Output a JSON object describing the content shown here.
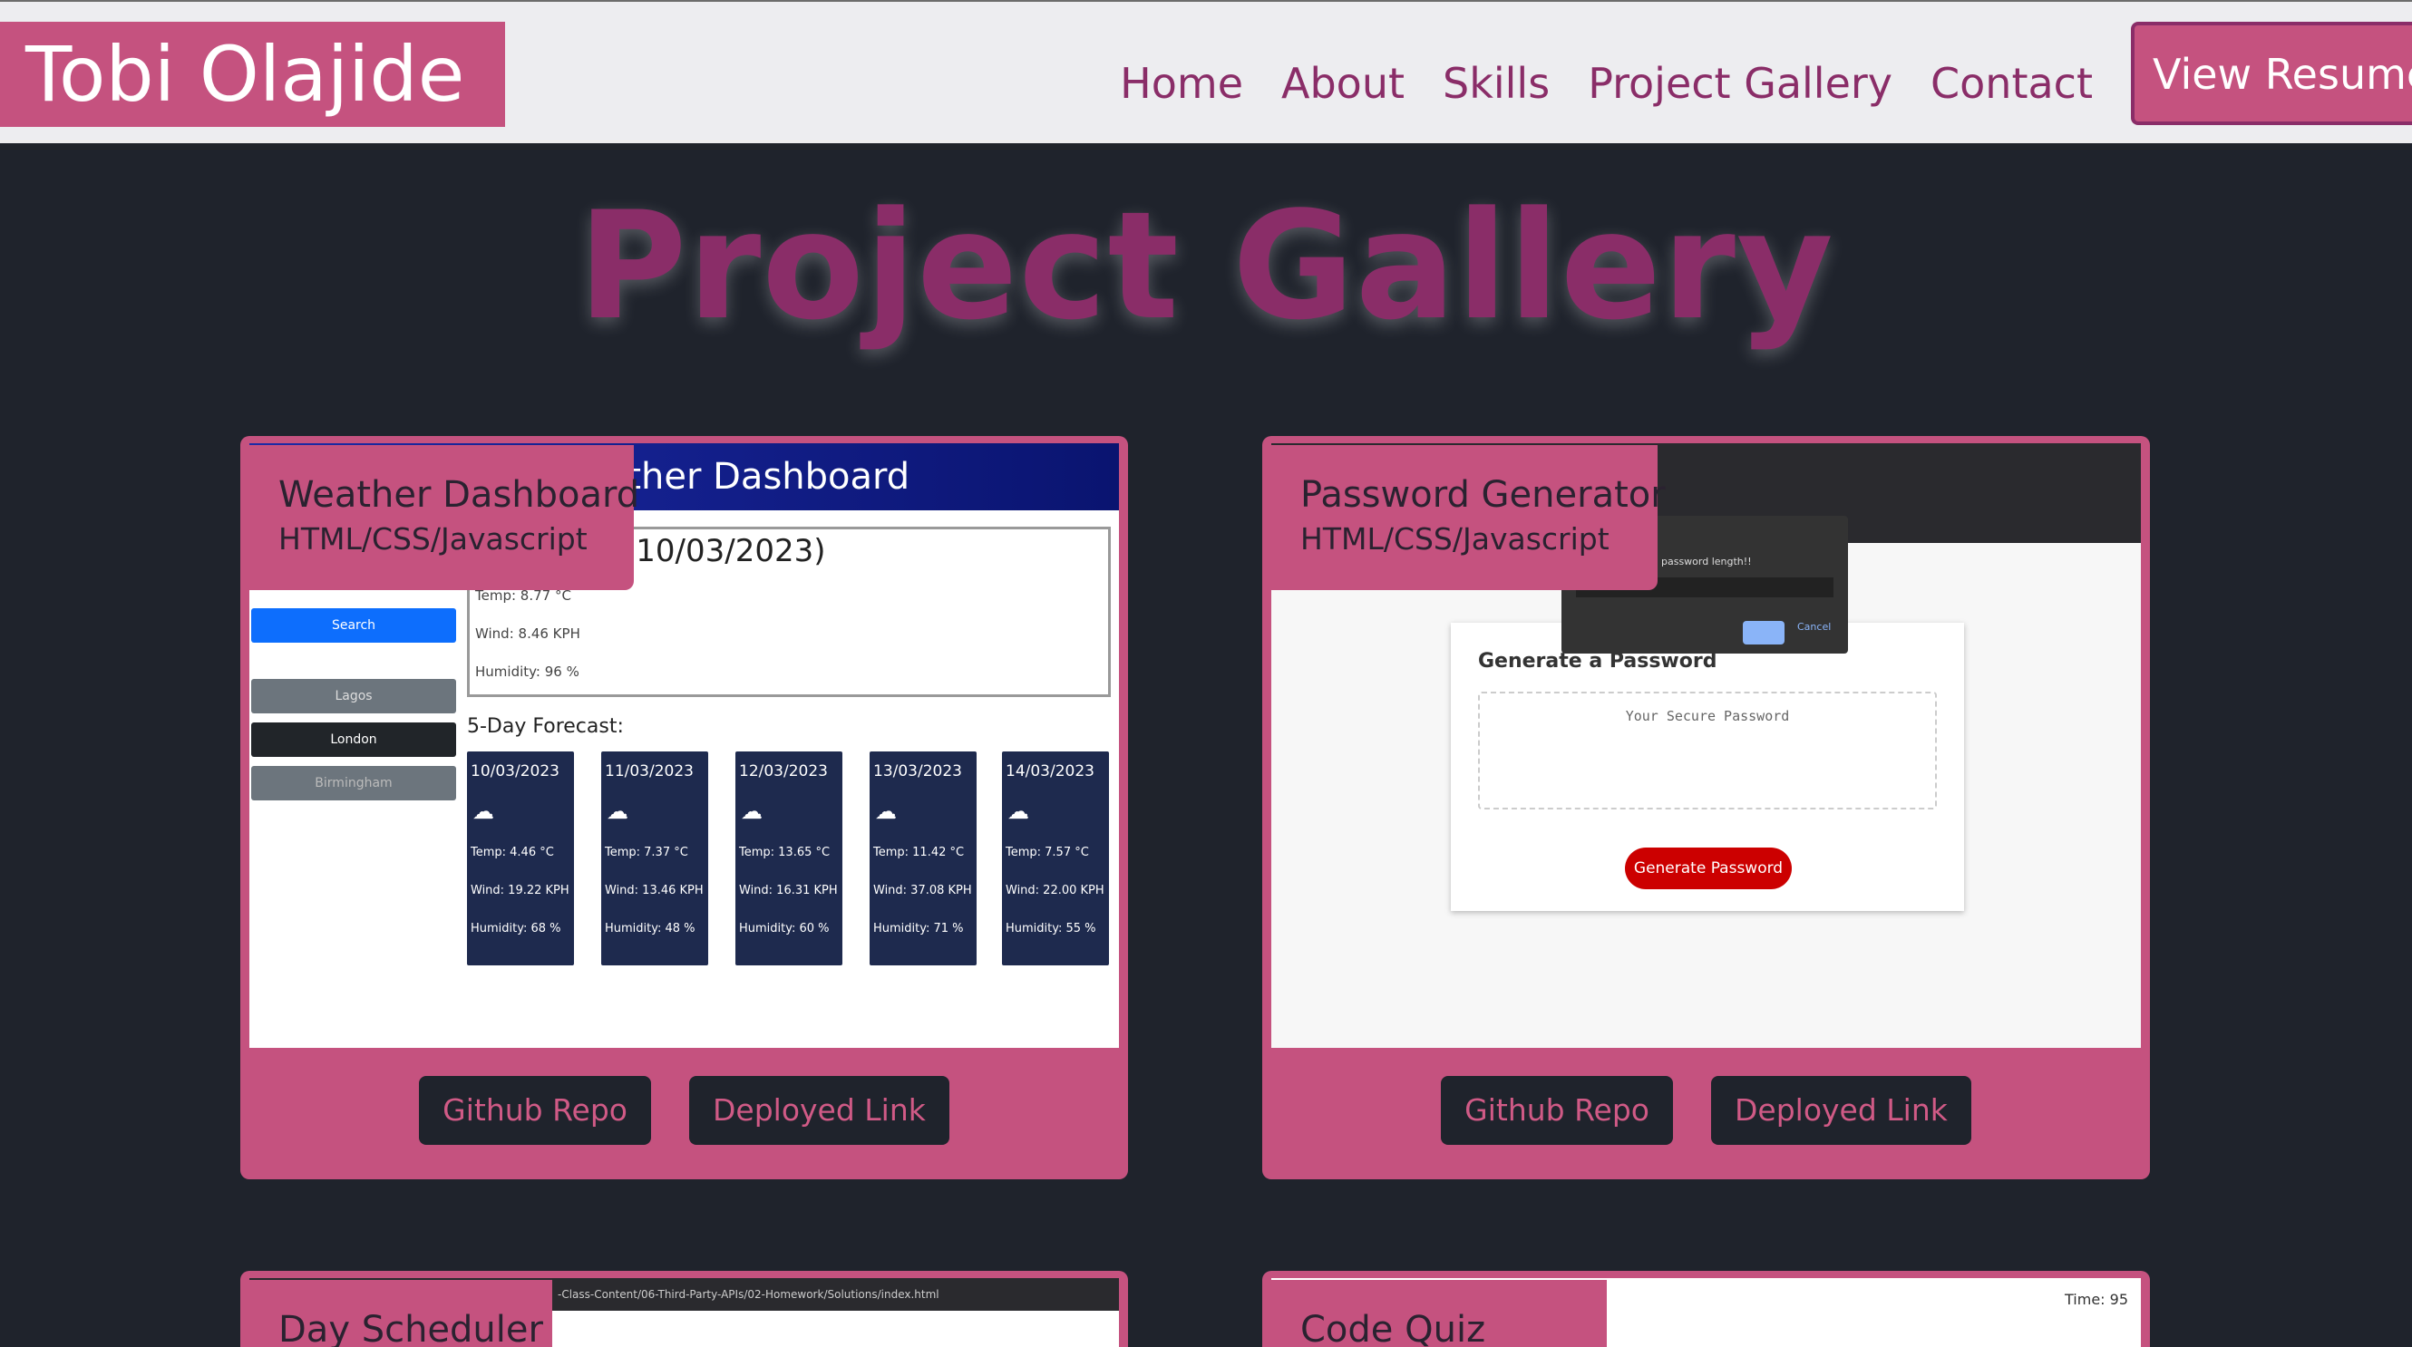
{
  "header": {
    "brand": "Tobi Olajide",
    "nav": [
      "Home",
      "About",
      "Skills",
      "Project Gallery",
      "Contact"
    ],
    "resume_label": "View Resume"
  },
  "page_title": "Project Gallery",
  "projects": [
    {
      "name": "Weather Dashboard",
      "tech": "HTML/CSS/Javascript",
      "repo_label": "Github Repo",
      "deployed_label": "Deployed Link",
      "screenshot": {
        "banner": "Weather Dashboard",
        "today_title": "(10/03/2023)",
        "today_temp": "Temp: 8.77 °C",
        "today_wind": "Wind: 8.46 KPH",
        "today_humidity": "Humidity: 96 %",
        "search_label": "Search",
        "history": [
          "Lagos",
          "London",
          "Birmingham"
        ],
        "forecast_title": "5-Day Forecast:",
        "forecast": [
          {
            "date": "10/03/2023",
            "temp": "Temp: 4.46 °C",
            "wind": "Wind: 19.22 KPH",
            "humidity": "Humidity: 68 %"
          },
          {
            "date": "11/03/2023",
            "temp": "Temp: 7.37 °C",
            "wind": "Wind: 13.46 KPH",
            "humidity": "Humidity: 48 %"
          },
          {
            "date": "12/03/2023",
            "temp": "Temp: 13.65 °C",
            "wind": "Wind: 16.31 KPH",
            "humidity": "Humidity: 60 %"
          },
          {
            "date": "13/03/2023",
            "temp": "Temp: 11.42 °C",
            "wind": "Wind: 37.08 KPH",
            "humidity": "Humidity: 71 %"
          },
          {
            "date": "14/03/2023",
            "temp": "Temp: 7.57 °C",
            "wind": "Wind: 22.00 KPH",
            "humidity": "Humidity: 55 %"
          }
        ]
      }
    },
    {
      "name": "Password Generator",
      "tech": "HTML/CSS/Javascript",
      "repo_label": "Github Repo",
      "deployed_label": "Deployed Link",
      "screenshot": {
        "dialog_text": "password length!!",
        "cancel_label": "Cancel",
        "box_title": "Generate a Password",
        "placeholder": "Your Secure Password",
        "button": "Generate Password"
      }
    },
    {
      "name": "Day Scheduler",
      "screenshot": {
        "address": "-Class-Content/06-Third-Party-APIs/02-Homework/Solutions/index.html"
      }
    },
    {
      "name": "Code Quiz",
      "screenshot": {
        "timer": "Time: 95"
      }
    }
  ],
  "colors": {
    "accent": "#c5527f",
    "dark": "#1f232c",
    "purple": "#8a2d68"
  }
}
